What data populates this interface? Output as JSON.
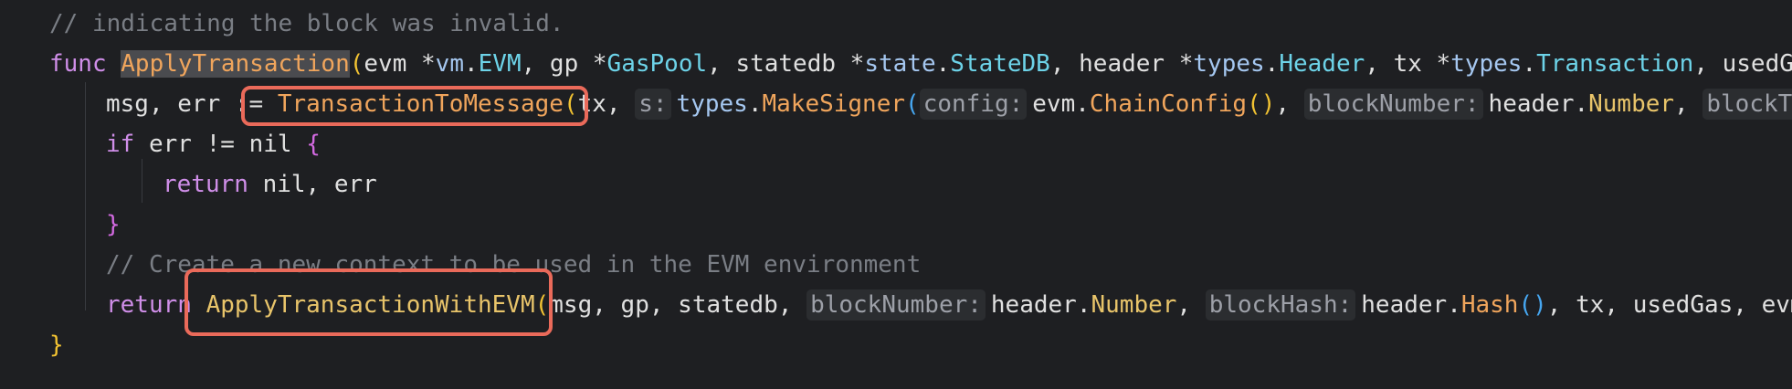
{
  "lines": [
    {
      "tokens": [
        {
          "text": "// indicating the block was invalid.",
          "cls": "comment"
        }
      ]
    },
    {
      "tokens": [
        {
          "text": "func ",
          "cls": "kw"
        },
        {
          "text": "ApplyTransaction",
          "cls": "fn sel"
        },
        {
          "text": "(",
          "cls": "paren-y"
        },
        {
          "text": "evm ",
          "cls": "ident"
        },
        {
          "text": "*",
          "cls": "ident"
        },
        {
          "text": "vm",
          "cls": "pkg"
        },
        {
          "text": ".",
          "cls": "ident"
        },
        {
          "text": "EVM",
          "cls": "typ"
        },
        {
          "text": ", ",
          "cls": "ident"
        },
        {
          "text": "gp ",
          "cls": "ident"
        },
        {
          "text": "*",
          "cls": "ident"
        },
        {
          "text": "GasPool",
          "cls": "typ"
        },
        {
          "text": ", ",
          "cls": "ident"
        },
        {
          "text": "statedb ",
          "cls": "ident"
        },
        {
          "text": "*",
          "cls": "ident"
        },
        {
          "text": "state",
          "cls": "pkg"
        },
        {
          "text": ".",
          "cls": "ident"
        },
        {
          "text": "StateDB",
          "cls": "typ"
        },
        {
          "text": ", ",
          "cls": "ident"
        },
        {
          "text": "header ",
          "cls": "ident"
        },
        {
          "text": "*",
          "cls": "ident"
        },
        {
          "text": "types",
          "cls": "pkg"
        },
        {
          "text": ".",
          "cls": "ident"
        },
        {
          "text": "Header",
          "cls": "typ"
        },
        {
          "text": ", ",
          "cls": "ident"
        },
        {
          "text": "tx ",
          "cls": "ident"
        },
        {
          "text": "*",
          "cls": "ident"
        },
        {
          "text": "types",
          "cls": "pkg"
        },
        {
          "text": ".",
          "cls": "ident"
        },
        {
          "text": "Transaction",
          "cls": "typ"
        },
        {
          "text": ", ",
          "cls": "ident"
        },
        {
          "text": "usedGa",
          "cls": "ident"
        }
      ]
    },
    {
      "tokens": [
        {
          "text": "msg",
          "cls": "ident"
        },
        {
          "text": ", ",
          "cls": "ident"
        },
        {
          "text": "err ",
          "cls": "ident"
        },
        {
          "text": ":= ",
          "cls": "ident"
        },
        {
          "text": "TransactionToMessage",
          "cls": "fn"
        },
        {
          "text": "(",
          "cls": "paren-y"
        },
        {
          "text": "tx",
          "cls": "ident"
        },
        {
          "text": ", ",
          "cls": "ident"
        },
        {
          "text": "s:",
          "cls": "hint"
        },
        {
          "text": "types",
          "cls": "pkg"
        },
        {
          "text": ".",
          "cls": "ident"
        },
        {
          "text": "MakeSigner",
          "cls": "fn"
        },
        {
          "text": "(",
          "cls": "paren-b"
        },
        {
          "text": "config:",
          "cls": "hint"
        },
        {
          "text": "evm",
          "cls": "ident"
        },
        {
          "text": ".",
          "cls": "ident"
        },
        {
          "text": "ChainConfig",
          "cls": "fn"
        },
        {
          "text": "()",
          "cls": "paren-y"
        },
        {
          "text": ", ",
          "cls": "ident"
        },
        {
          "text": "blockNumber:",
          "cls": "hint"
        },
        {
          "text": "header",
          "cls": "ident"
        },
        {
          "text": ".",
          "cls": "ident"
        },
        {
          "text": "Number",
          "cls": "field"
        },
        {
          "text": ", ",
          "cls": "ident"
        },
        {
          "text": "blockTim",
          "cls": "hint"
        }
      ]
    },
    {
      "tokens": [
        {
          "text": "if ",
          "cls": "kw"
        },
        {
          "text": "err ",
          "cls": "ident"
        },
        {
          "text": "!= ",
          "cls": "ident"
        },
        {
          "text": "nil ",
          "cls": "ident"
        },
        {
          "text": "{",
          "cls": "paren-p"
        }
      ]
    },
    {
      "tokens": [
        {
          "text": "return ",
          "cls": "kw"
        },
        {
          "text": "nil",
          "cls": "ident"
        },
        {
          "text": ", ",
          "cls": "ident"
        },
        {
          "text": "err",
          "cls": "ident"
        }
      ]
    },
    {
      "tokens": [
        {
          "text": "}",
          "cls": "paren-p"
        }
      ]
    },
    {
      "tokens": [
        {
          "text": "// Create a new context to be used in the EVM environment",
          "cls": "comment"
        }
      ]
    },
    {
      "tokens": [
        {
          "text": "return ",
          "cls": "kw"
        },
        {
          "text": "ApplyTransactionWithEVM",
          "cls": "fnlight"
        },
        {
          "text": "(",
          "cls": "paren-y"
        },
        {
          "text": "msg",
          "cls": "ident"
        },
        {
          "text": ", ",
          "cls": "ident"
        },
        {
          "text": "gp",
          "cls": "ident"
        },
        {
          "text": ", ",
          "cls": "ident"
        },
        {
          "text": "statedb",
          "cls": "ident"
        },
        {
          "text": ", ",
          "cls": "ident"
        },
        {
          "text": "blockNumber:",
          "cls": "hint"
        },
        {
          "text": "header",
          "cls": "ident"
        },
        {
          "text": ".",
          "cls": "ident"
        },
        {
          "text": "Number",
          "cls": "field"
        },
        {
          "text": ", ",
          "cls": "ident"
        },
        {
          "text": "blockHash:",
          "cls": "hint"
        },
        {
          "text": "header",
          "cls": "ident"
        },
        {
          "text": ".",
          "cls": "ident"
        },
        {
          "text": "Hash",
          "cls": "fn"
        },
        {
          "text": "()",
          "cls": "paren-b"
        },
        {
          "text": ", ",
          "cls": "ident"
        },
        {
          "text": "tx",
          "cls": "ident"
        },
        {
          "text": ", ",
          "cls": "ident"
        },
        {
          "text": "usedGas",
          "cls": "ident"
        },
        {
          "text": ", ",
          "cls": "ident"
        },
        {
          "text": "evm",
          "cls": "ident"
        },
        {
          "text": ")",
          "cls": "paren-y"
        }
      ]
    },
    {
      "tokens": [
        {
          "text": "}",
          "cls": "paren-y"
        }
      ]
    }
  ],
  "colors": {
    "background": "#1e1f22",
    "highlight_box": "#ea6a5a"
  }
}
